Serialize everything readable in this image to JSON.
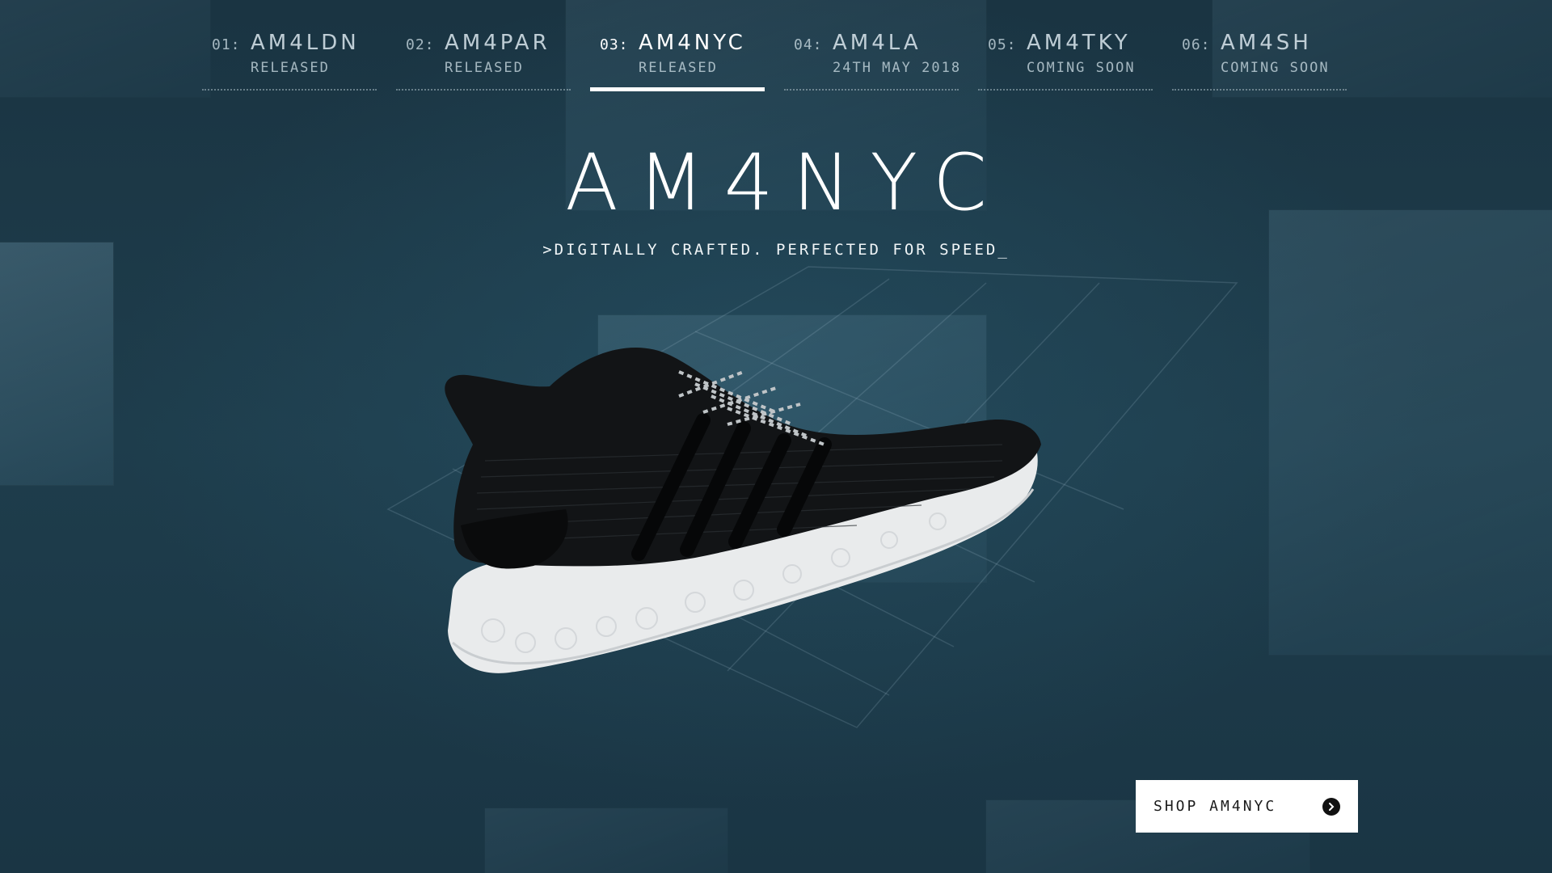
{
  "nav": {
    "items": [
      {
        "num": "01:",
        "name": "AM4LDN",
        "status": "RELEASED",
        "active": false
      },
      {
        "num": "02:",
        "name": "AM4PAR",
        "status": "RELEASED",
        "active": false
      },
      {
        "num": "03:",
        "name": "AM4NYC",
        "status": "RELEASED",
        "active": true
      },
      {
        "num": "04:",
        "name": "AM4LA",
        "status": "24TH MAY 2018",
        "active": false
      },
      {
        "num": "05:",
        "name": "AM4TKY",
        "status": "COMING SOON",
        "active": false
      },
      {
        "num": "06:",
        "name": "AM4SH",
        "status": "COMING SOON",
        "active": false
      }
    ]
  },
  "hero": {
    "title": "AM4NYC",
    "tagline": ">DIGITALLY CRAFTED. PERFECTED FOR SPEED_"
  },
  "shop": {
    "label": "SHOP AM4NYC",
    "icon": "arrow-right-circle-icon"
  },
  "colors": {
    "background": "#1d3a49",
    "active": "#ffffff",
    "button_bg": "#ffffff",
    "button_text": "#1b1b1b"
  }
}
